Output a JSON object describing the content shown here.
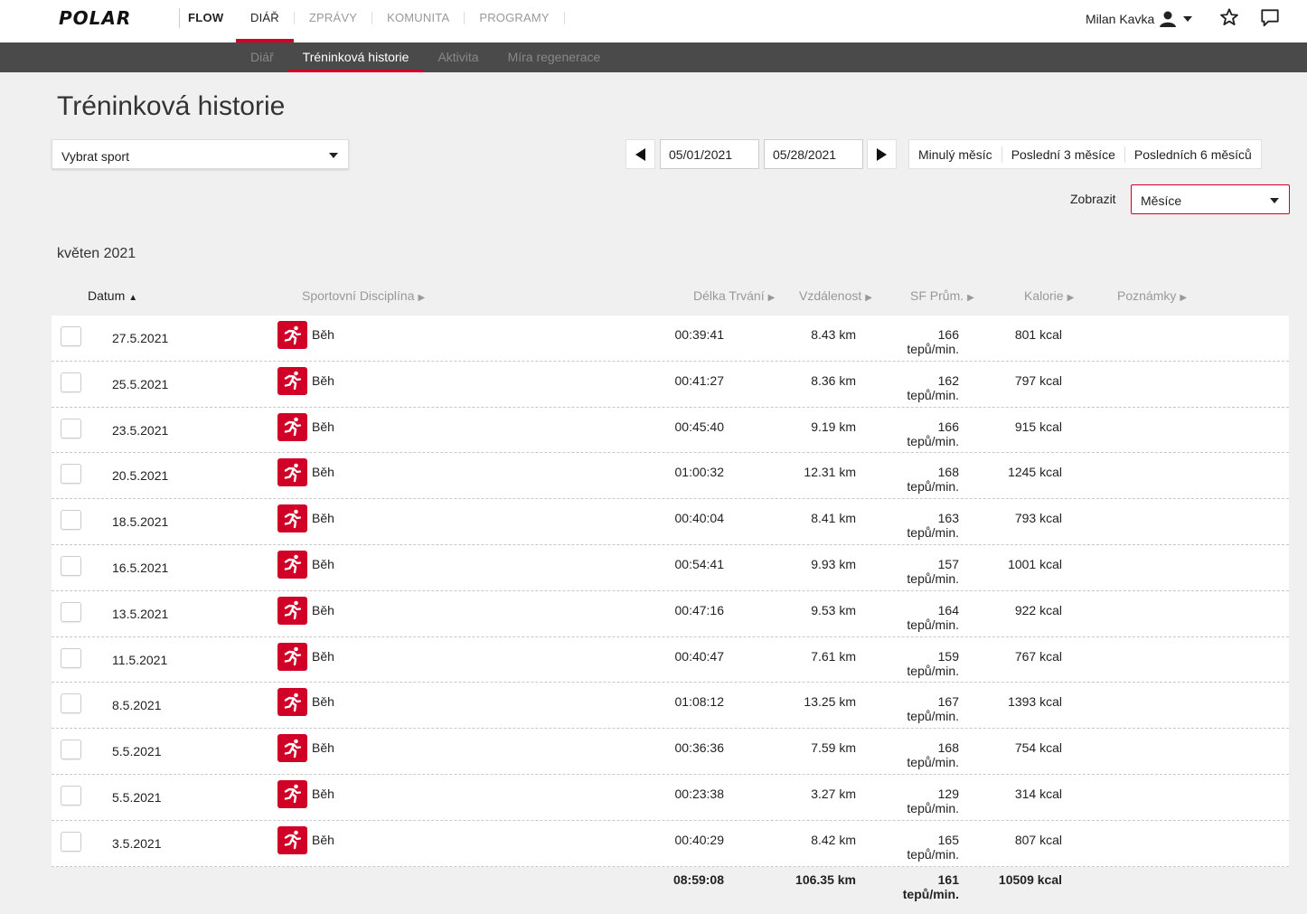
{
  "brand": {
    "logo": "POLAR",
    "product": "FLOW"
  },
  "main_nav": [
    {
      "label": "DIÁŘ",
      "active": true
    },
    {
      "label": "ZPRÁVY",
      "active": false
    },
    {
      "label": "KOMUNITA",
      "active": false
    },
    {
      "label": "PROGRAMY",
      "active": false
    }
  ],
  "user": {
    "name": "Milan Kavka"
  },
  "sub_nav": [
    {
      "label": "Diář",
      "active": false
    },
    {
      "label": "Tréninková historie",
      "active": true
    },
    {
      "label": "Aktivita",
      "active": false
    },
    {
      "label": "Míra regenerace",
      "active": false
    }
  ],
  "page": {
    "title": "Tréninková historie"
  },
  "filters": {
    "sport_select": "Vybrat sport",
    "date_from": "05/01/2021",
    "date_to": "05/28/2021",
    "quick_ranges": [
      "Minulý měsíc",
      "Poslední 3 měsíce",
      "Posledních 6 měsíců"
    ],
    "show_label": "Zobrazit",
    "show_value": "Měsíce"
  },
  "month": "květen 2021",
  "columns": {
    "date": "Datum",
    "sport": "Sportovní Disciplína",
    "duration": "Délka Trvání",
    "distance": "Vzdálenost",
    "hr": "SF Prům.",
    "calories": "Kalorie",
    "notes": "Poznámky"
  },
  "hr_unit": "tepů/min.",
  "rows": [
    {
      "date": "27.5.2021",
      "sport": "Běh",
      "duration": "00:39:41",
      "distance": "8.43 km",
      "hr": "166",
      "calories": "801 kcal"
    },
    {
      "date": "25.5.2021",
      "sport": "Běh",
      "duration": "00:41:27",
      "distance": "8.36 km",
      "hr": "162",
      "calories": "797 kcal"
    },
    {
      "date": "23.5.2021",
      "sport": "Běh",
      "duration": "00:45:40",
      "distance": "9.19 km",
      "hr": "166",
      "calories": "915 kcal"
    },
    {
      "date": "20.5.2021",
      "sport": "Běh",
      "duration": "01:00:32",
      "distance": "12.31 km",
      "hr": "168",
      "calories": "1245 kcal"
    },
    {
      "date": "18.5.2021",
      "sport": "Běh",
      "duration": "00:40:04",
      "distance": "8.41 km",
      "hr": "163",
      "calories": "793 kcal"
    },
    {
      "date": "16.5.2021",
      "sport": "Běh",
      "duration": "00:54:41",
      "distance": "9.93 km",
      "hr": "157",
      "calories": "1001 kcal"
    },
    {
      "date": "13.5.2021",
      "sport": "Běh",
      "duration": "00:47:16",
      "distance": "9.53 km",
      "hr": "164",
      "calories": "922 kcal"
    },
    {
      "date": "11.5.2021",
      "sport": "Běh",
      "duration": "00:40:47",
      "distance": "7.61 km",
      "hr": "159",
      "calories": "767 kcal"
    },
    {
      "date": "8.5.2021",
      "sport": "Běh",
      "duration": "01:08:12",
      "distance": "13.25 km",
      "hr": "167",
      "calories": "1393 kcal"
    },
    {
      "date": "5.5.2021",
      "sport": "Běh",
      "duration": "00:36:36",
      "distance": "7.59 km",
      "hr": "168",
      "calories": "754 kcal"
    },
    {
      "date": "5.5.2021",
      "sport": "Běh",
      "duration": "00:23:38",
      "distance": "3.27 km",
      "hr": "129",
      "calories": "314 kcal"
    },
    {
      "date": "3.5.2021",
      "sport": "Běh",
      "duration": "00:40:29",
      "distance": "8.42 km",
      "hr": "165",
      "calories": "807 kcal"
    }
  ],
  "totals": {
    "duration": "08:59:08",
    "distance": "106.35 km",
    "hr": "161",
    "calories": "10509 kcal"
  },
  "colors": {
    "accent": "#d10027",
    "subbar": "#4a4a4a",
    "background": "#f0f0f0"
  }
}
